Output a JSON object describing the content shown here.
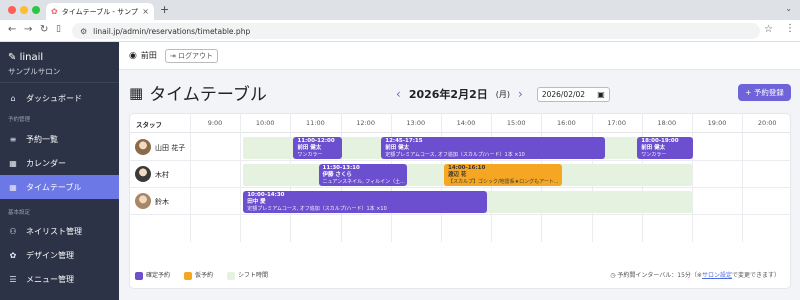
{
  "browser": {
    "tab_title": "タイムテーブル - サンプルサロン",
    "url": "linail.jp/admin/reservations/timetable.php"
  },
  "sidebar": {
    "brand": "linail",
    "brand_sub": "サンプルサロン",
    "items": [
      {
        "label": "ダッシュボード",
        "icon": "home-icon",
        "active": false
      },
      {
        "label": "予約一覧",
        "icon": "list-icon",
        "active": false
      },
      {
        "label": "カレンダー",
        "icon": "calendar-icon",
        "active": false
      },
      {
        "label": "タイムテーブル",
        "icon": "calendar-icon",
        "active": true
      },
      {
        "label": "ネイリスト管理",
        "icon": "users-icon",
        "active": false
      },
      {
        "label": "デザイン管理",
        "icon": "palette-icon",
        "active": false
      },
      {
        "label": "メニュー管理",
        "icon": "menu-icon",
        "active": false
      }
    ],
    "section_labels": [
      "予約管理",
      "基本設定"
    ]
  },
  "topbar": {
    "user_name": "前田",
    "logout_label": "ログアウト"
  },
  "page": {
    "title": "タイムテーブル",
    "date_display": "2026年2月2日",
    "day_of_week": "(月)",
    "date_input": "2026/02/02",
    "add_button": "+ 予約登録"
  },
  "timetable": {
    "staff_header": "スタッフ",
    "hours": [
      "9:00",
      "10:00",
      "11:00",
      "12:00",
      "13:00",
      "14:00",
      "15:00",
      "16:00",
      "17:00",
      "18:00",
      "19:00",
      "20:00"
    ],
    "staff": [
      {
        "name": "山田 花子",
        "shift": {
          "start": 10.0,
          "end": 19.0
        },
        "reservations": [
          {
            "time": "11:00-12:00",
            "customer": "前田 健太",
            "menu": "ワンカラー",
            "type": "confirmed",
            "start": 11.0,
            "end": 12.0
          },
          {
            "time": "12:45-17:15",
            "customer": "前田 健太",
            "menu": "定額プレミアムコース, オフ追加（スカルプ/ハード）1本 ×10",
            "type": "confirmed",
            "start": 12.75,
            "end": 17.25
          },
          {
            "time": "18:00-19:00",
            "customer": "前田 健太",
            "menu": "ワンカラー",
            "type": "confirmed",
            "start": 17.85,
            "end": 19.0
          }
        ]
      },
      {
        "name": "木村",
        "shift": {
          "start": 10.0,
          "end": 19.0
        },
        "reservations": [
          {
            "time": "11:30-13:10",
            "customer": "伊藤 さくら",
            "menu": "ニュアンスネイル, フィルイン（土...",
            "type": "confirmed",
            "start": 11.5,
            "end": 13.3
          },
          {
            "time": "14:00-16:10",
            "customer": "渡辺 花",
            "menu": "【スカルプ】ゴシック/地雷系★ロングもアート...",
            "type": "tentative",
            "start": 14.0,
            "end": 16.4
          }
        ]
      },
      {
        "name": "鈴木",
        "shift": {
          "start": 10.0,
          "end": 19.0
        },
        "reservations": [
          {
            "time": "10:00-14:30",
            "customer": "田中 愛",
            "menu": "定額プレミアムコース, オフ追加（スカルプ/ハード）1本 ×10",
            "type": "confirmed",
            "start": 10.0,
            "end": 14.9
          }
        ]
      }
    ]
  },
  "legend": {
    "confirmed": "確定予約",
    "tentative": "仮予約",
    "shift": "シフト時間",
    "interval_prefix": "予約間インターバル：15分（※",
    "interval_link": "サロン設定",
    "interval_suffix": "で変更できます）"
  },
  "colors": {
    "sidebar_bg": "#2c3346",
    "active_item": "#6c78e6",
    "confirmed": "#6b4fcf",
    "tentative": "#f5a623",
    "shift": "#e4f2df",
    "accent": "#6e63d9"
  }
}
